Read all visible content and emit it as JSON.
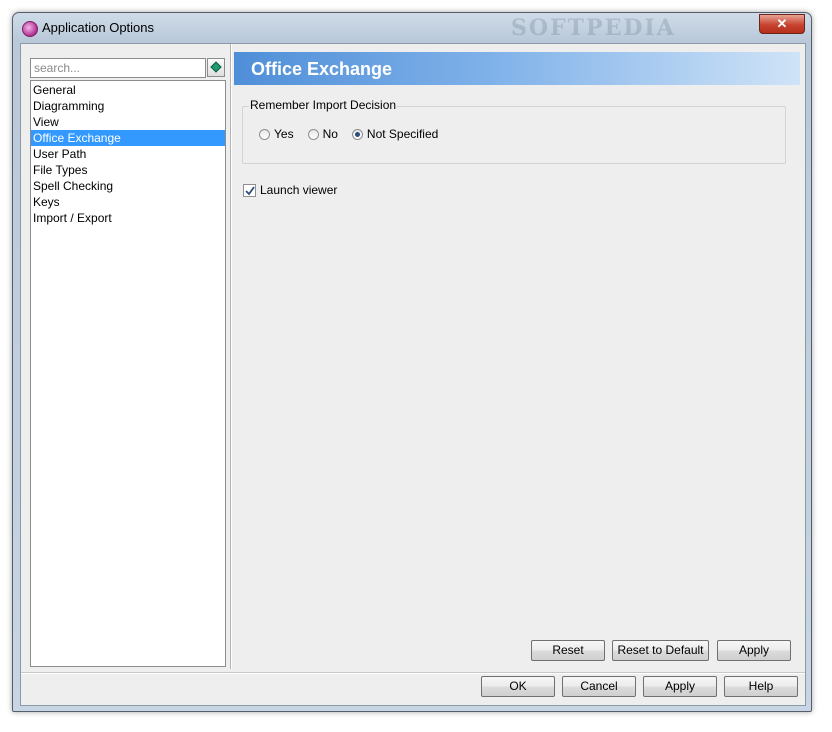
{
  "window": {
    "title": "Application Options",
    "watermark": "SOFTPEDIA",
    "close_glyph": "✕"
  },
  "sidebar": {
    "search_placeholder": "search...",
    "items": [
      {
        "label": "General",
        "selected": false
      },
      {
        "label": "Diagramming",
        "selected": false
      },
      {
        "label": "View",
        "selected": false
      },
      {
        "label": "Office Exchange",
        "selected": true
      },
      {
        "label": "User Path",
        "selected": false
      },
      {
        "label": "File Types",
        "selected": false
      },
      {
        "label": "Spell Checking",
        "selected": false
      },
      {
        "label": "Keys",
        "selected": false
      },
      {
        "label": "Import / Export",
        "selected": false
      }
    ]
  },
  "main": {
    "header_title": "Office Exchange",
    "remember_group": {
      "legend": "Remember Import Decision",
      "options": [
        {
          "label": "Yes",
          "checked": false
        },
        {
          "label": "No",
          "checked": false
        },
        {
          "label": "Not Specified",
          "checked": true
        }
      ]
    },
    "launch_viewer": {
      "label": "Launch viewer",
      "checked": true
    },
    "panel_buttons": {
      "reset": "Reset",
      "reset_default": "Reset to Default",
      "apply": "Apply"
    }
  },
  "dialog_buttons": {
    "ok": "OK",
    "cancel": "Cancel",
    "apply": "Apply",
    "help": "Help"
  },
  "colors": {
    "selection": "#3399ff",
    "banner_start": "#4f8fd8",
    "banner_end": "#cfe3f7",
    "close_button": "#c7432f"
  }
}
